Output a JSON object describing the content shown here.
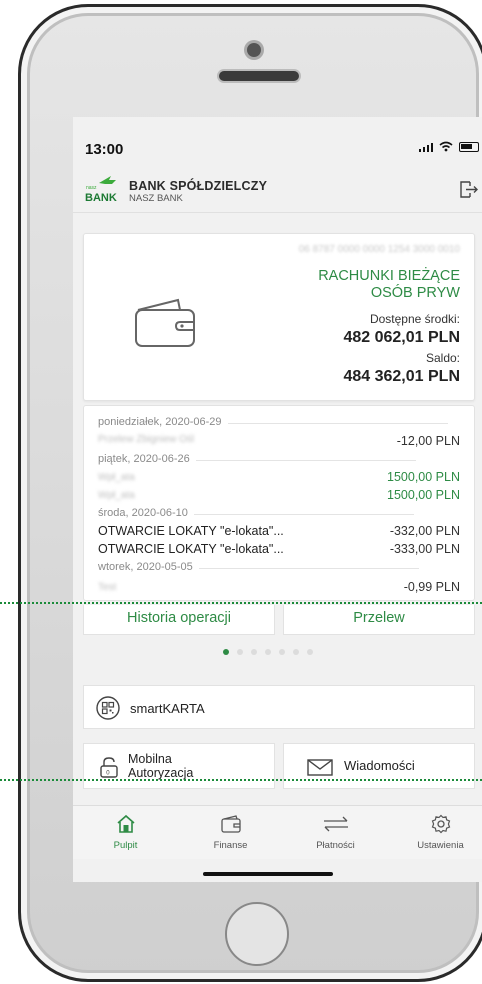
{
  "status": {
    "time": "13:00"
  },
  "header": {
    "bank_name": "BANK SPÓŁDZIELCZY",
    "bank_subname": "NASZ BANK",
    "logo_text": "BANK",
    "logo_small": "nasz"
  },
  "account": {
    "number": "06 8787 0000 0000 1254 3000 0010",
    "name_line1": "RACHUNKI BIEŻĄCE",
    "name_line2": "OSÓB PRYW",
    "available_label": "Dostępne środki:",
    "available_value": "482 062,01 PLN",
    "balance_label": "Saldo:",
    "balance_value": "484 362,01 PLN"
  },
  "operations": [
    {
      "day": "poniedziałek, 2020-06-29",
      "items": [
        {
          "desc": "Przelew Zbigniew Ośl",
          "amount": "-12,00 PLN",
          "positive": false,
          "blurred": true
        }
      ]
    },
    {
      "day": "piątek, 2020-06-26",
      "items": [
        {
          "desc": "Wpł_ata",
          "amount": "1500,00 PLN",
          "positive": true,
          "blurred": true
        },
        {
          "desc": "Wpł_ata",
          "amount": "1500,00 PLN",
          "positive": true,
          "blurred": true
        }
      ]
    },
    {
      "day": "środa, 2020-06-10",
      "items": [
        {
          "desc": "OTWARCIE LOKATY \"e-lokata\"...",
          "amount": "-332,00 PLN",
          "positive": false,
          "blurred": false
        },
        {
          "desc": "OTWARCIE LOKATY \"e-lokata\"...",
          "amount": "-333,00 PLN",
          "positive": false,
          "blurred": false
        }
      ]
    },
    {
      "day": "wtorek, 2020-05-05",
      "items": [
        {
          "desc": "Test",
          "amount": "-0,99 PLN",
          "positive": false,
          "blurred": true
        }
      ]
    }
  ],
  "buttons": {
    "history": "Historia operacji",
    "transfer": "Przelew"
  },
  "tiles": {
    "smartkarta": "smartKARTA",
    "mobile_auth_line1": "Mobilna",
    "mobile_auth_line2": "Autoryzacja",
    "messages": "Wiadomości"
  },
  "tabs": [
    {
      "label": "Pulpit",
      "icon": "home-icon",
      "active": true
    },
    {
      "label": "Finanse",
      "icon": "wallet-icon",
      "active": false
    },
    {
      "label": "Płatności",
      "icon": "transfer-arrows-icon",
      "active": false
    },
    {
      "label": "Ustawienia",
      "icon": "gear-icon",
      "active": false
    }
  ],
  "colors": {
    "brand_green": "#2e8b45",
    "highlight_dotted": "#1b8b3a"
  }
}
